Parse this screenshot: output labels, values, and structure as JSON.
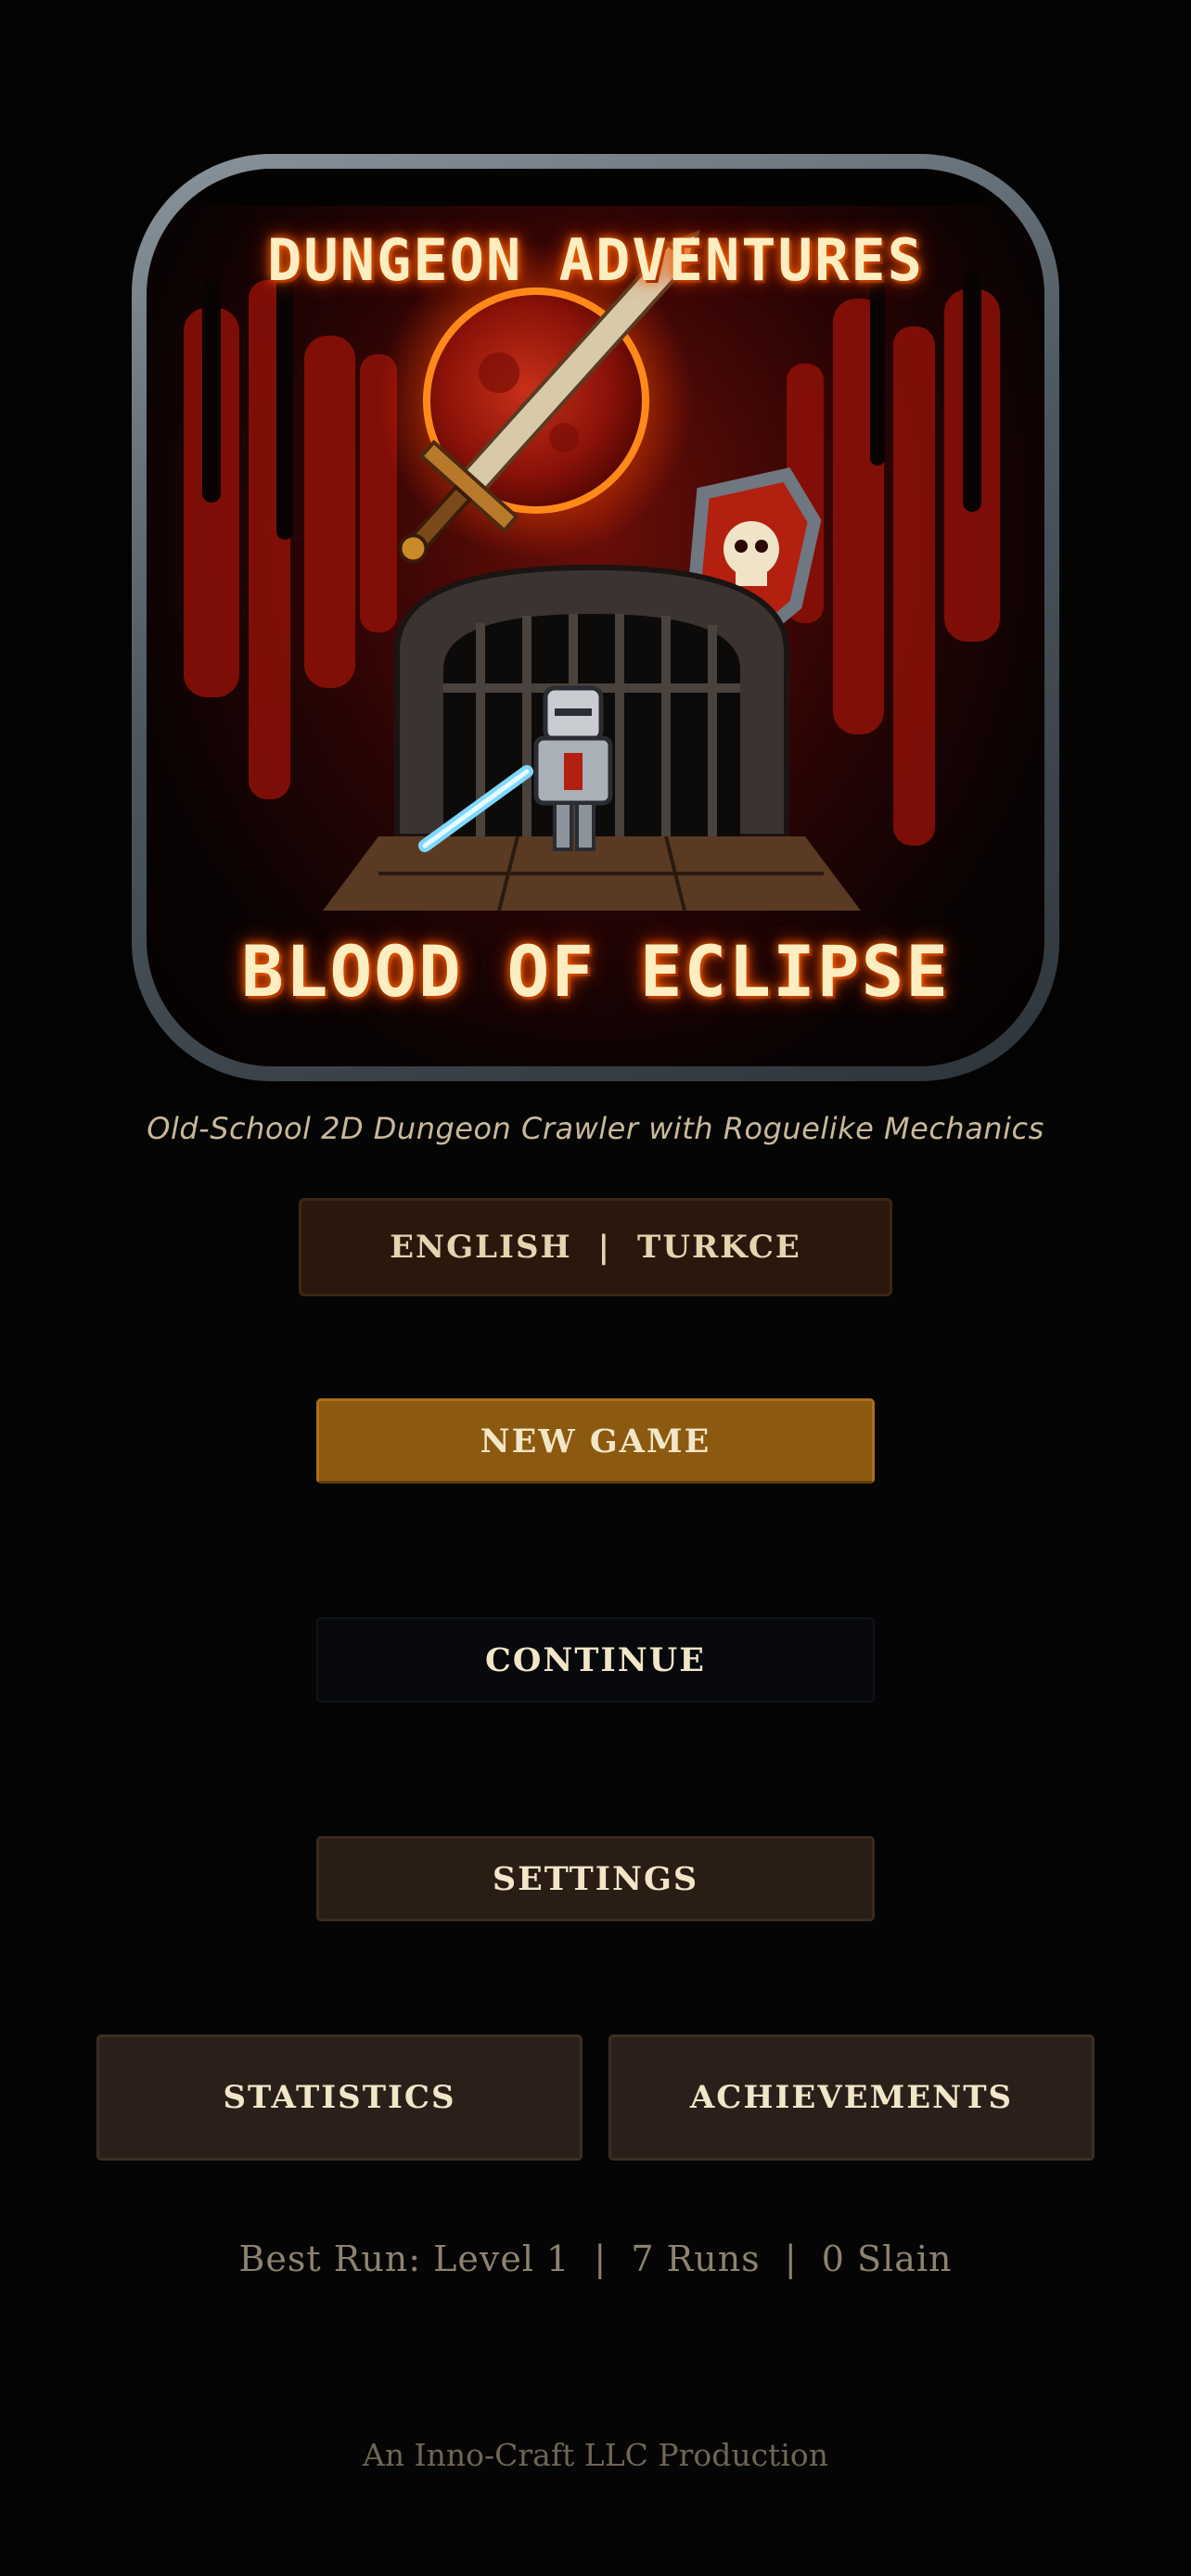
{
  "logo": {
    "title_top": "DUNGEON ADVENTURES",
    "title_bottom": "BLOOD OF ECLIPSE",
    "colors": {
      "frame": "#5a646c",
      "moon": "#b3200f",
      "blood": "#c0180c",
      "title": "#fdeec2"
    }
  },
  "tagline": "Old-School 2D Dungeon Crawler with Roguelike Mechanics",
  "language": {
    "english": "ENGLISH",
    "separator": "|",
    "turkish": "TURKCE"
  },
  "menu": {
    "new_game": "NEW GAME",
    "continue": "CONTINUE",
    "settings": "SETTINGS",
    "statistics": "STATISTICS",
    "achievements": "ACHIEVEMENTS"
  },
  "stats_line": "Best Run: Level 1  |  7 Runs  |  0 Slain",
  "credit": "An Inno-Craft LLC Production",
  "colors": {
    "background": "#050505",
    "new_game_button": "#8b5a10",
    "language_button": "#2a180c",
    "continue_button": "#07090c",
    "settings_button": "#2a1d14",
    "secondary_button": "#2b2019"
  }
}
